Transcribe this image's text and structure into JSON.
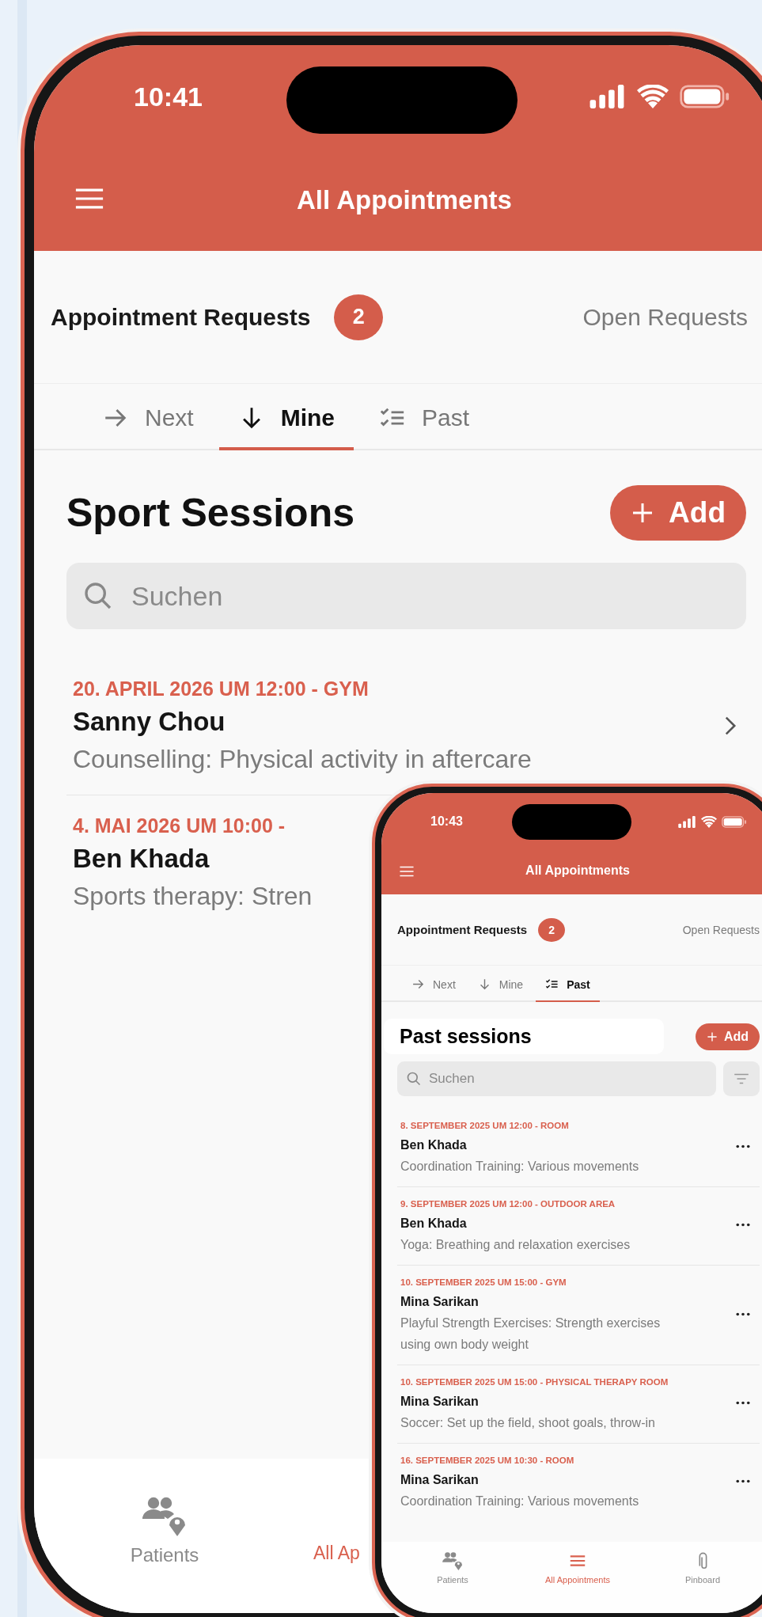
{
  "phones": [
    {
      "status_time": "10:41",
      "header_title": "All Appointments",
      "requests": {
        "title": "Appointment Requests",
        "count": "2",
        "link": "Open Requests"
      },
      "tabs": [
        {
          "label": "Next",
          "selected": false
        },
        {
          "label": "Mine",
          "selected": true
        },
        {
          "label": "Past",
          "selected": false
        }
      ],
      "section_title": "Sport Sessions",
      "add_label": "Add",
      "search_placeholder": "Suchen",
      "filter_button": false,
      "items": [
        {
          "date": "20. APRIL 2026 UM 12:00 - GYM",
          "name": "Sanny Chou",
          "description": "Counselling: Physical activity in aftercare"
        },
        {
          "date": "4. MAI 2026 UM 10:00 -",
          "name": "Ben Khada",
          "description": "Sports therapy: Stren"
        }
      ],
      "bottom_tabs": [
        {
          "label": "Patients",
          "selected": false
        },
        {
          "label": "All Ap",
          "selected": true
        }
      ]
    },
    {
      "status_time": "10:43",
      "header_title": "All Appointments",
      "requests": {
        "title": "Appointment Requests",
        "count": "2",
        "link": "Open Requests"
      },
      "tabs": [
        {
          "label": "Next",
          "selected": false
        },
        {
          "label": "Mine",
          "selected": false
        },
        {
          "label": "Past",
          "selected": true
        }
      ],
      "section_title": "Past sessions",
      "add_label": "Add",
      "search_placeholder": "Suchen",
      "filter_button": true,
      "items": [
        {
          "date": "8. SEPTEMBER 2025 UM 12:00 - ROOM",
          "name": "Ben Khada",
          "description": "Coordination Training: Various movements"
        },
        {
          "date": "9. SEPTEMBER 2025 UM 12:00 - OUTDOOR AREA",
          "name": "Ben Khada",
          "description": "Yoga: Breathing and relaxation exercises"
        },
        {
          "date": "10. SEPTEMBER 2025 UM 15:00 - GYM",
          "name": "Mina Sarikan",
          "description": "Playful Strength Exercises: Strength exercises using own body weight"
        },
        {
          "date": "10. SEPTEMBER 2025 UM 15:00 - PHYSICAL THERAPY ROOM",
          "name": "Mina Sarikan",
          "description": "Soccer: Set up the field, shoot goals, throw-in"
        },
        {
          "date": "16. SEPTEMBER 2025 UM 10:30 - ROOM",
          "name": "Mina Sarikan",
          "description": "Coordination Training: Various movements"
        }
      ],
      "bottom_tabs": [
        {
          "label": "Patients",
          "selected": false
        },
        {
          "label": "All Appointments",
          "selected": true
        },
        {
          "label": "Pinboard",
          "selected": false
        }
      ]
    }
  ]
}
